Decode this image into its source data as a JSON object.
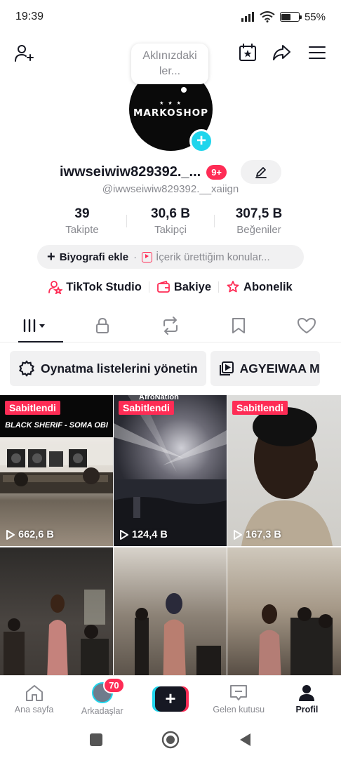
{
  "status_bar": {
    "time": "19:39",
    "battery": "55%",
    "battery_level": 0.55
  },
  "bubble": {
    "text": "Aklınızdaki ler..."
  },
  "avatar": {
    "brand": "MARKOSHOP",
    "stars": "★ ★ ★"
  },
  "profile": {
    "username": "iwwseiwiw829392._...",
    "notifications": "9+",
    "handle": "@iwwseiwiw829392.__xaiign"
  },
  "stats": [
    {
      "value": "39",
      "label": "Takipte"
    },
    {
      "value": "30,6 B",
      "label": "Takipçi"
    },
    {
      "value": "307,5 B",
      "label": "Beğeniler"
    }
  ],
  "bio": {
    "add_label": "Biyografi ekle",
    "separator": "·",
    "topics": "İçerik ürettiğim konular..."
  },
  "links": {
    "studio": "TikTok Studio",
    "balance": "Bakiye",
    "subscription": "Abonelik"
  },
  "playlists": {
    "manage": "Oynatma listelerini yönetin",
    "playlist1": "AGYEIWAA M"
  },
  "videos": [
    {
      "pinned": "Sabitlendi",
      "views": "662,6 B",
      "caption": "BLACK SHERIF - SOMA OBI"
    },
    {
      "pinned": "Sabitlendi",
      "views": "124,4 B",
      "caption": "AfroNation"
    },
    {
      "pinned": "Sabitlendi",
      "views": "167,3 B",
      "caption": ""
    },
    {
      "pinned": "",
      "views": "",
      "caption": ""
    },
    {
      "pinned": "",
      "views": "",
      "caption": ""
    },
    {
      "pinned": "",
      "views": "",
      "caption": ""
    }
  ],
  "bottom_nav": {
    "home": "Ana sayfa",
    "friends": "Arkadaşlar",
    "friends_badge": "70",
    "create": "+",
    "inbox": "Gelen kutusu",
    "profile": "Profil"
  },
  "colors": {
    "accent": "#fe2c55",
    "cyan": "#20d5ec",
    "text": "#161823",
    "muted": "#8a8b91"
  }
}
